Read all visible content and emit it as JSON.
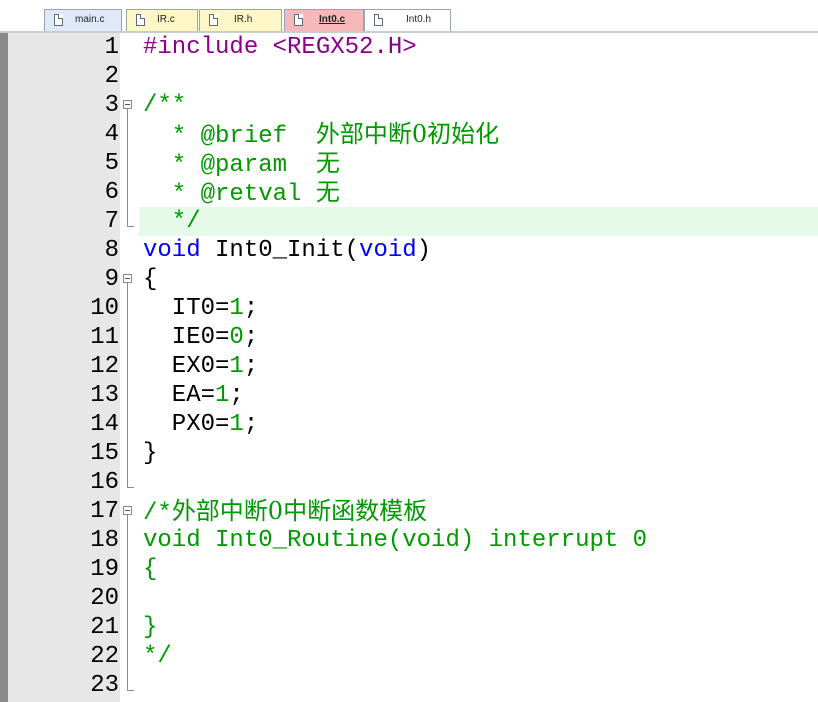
{
  "tabs": [
    {
      "label": "main.c",
      "icon": "file-icon"
    },
    {
      "label": "IR.c",
      "icon": "file-icon"
    },
    {
      "label": "IR.h",
      "icon": "file-icon"
    },
    {
      "label": "Int0.c",
      "icon": "file-icon",
      "active": true
    },
    {
      "label": "Int0.h",
      "icon": "file-icon"
    }
  ],
  "colors": {
    "preprocessor": "#8b008b",
    "comment": "#009a00",
    "keyword": "#0000ff",
    "number": "#009a00",
    "active_tab": "#f6b8b8",
    "current_line": "#e5fae8"
  },
  "code": {
    "line_numbers": [
      "1",
      "2",
      "3",
      "4",
      "5",
      "6",
      "7",
      "8",
      "9",
      "10",
      "11",
      "12",
      "13",
      "14",
      "15",
      "16",
      "17",
      "18",
      "19",
      "20",
      "21",
      "22",
      "23"
    ],
    "l1": "#include <REGX52.H>",
    "l3": "/**",
    "l4a": "  * @brief  ",
    "l4b": "外部中断0初始化",
    "l5a": "  * @param  ",
    "l5b": "无",
    "l6a": "  * @retval ",
    "l6b": "无",
    "l7": "  */",
    "l8_kw1": "void",
    "l8_name": " Int0_Init(",
    "l8_kw2": "void",
    "l8_end": ")",
    "l9": "{",
    "l10a": "  IT0=",
    "l10n": "1",
    "l10b": ";",
    "l11a": "  IE0=",
    "l11n": "0",
    "l11b": ";",
    "l12a": "  EX0=",
    "l12n": "1",
    "l12b": ";",
    "l13a": "  EA=",
    "l13n": "1",
    "l13b": ";",
    "l14a": "  PX0=",
    "l14n": "1",
    "l14b": ";",
    "l15": "}",
    "l17a": "/*",
    "l17b": "外部中断0中断函数模板",
    "l18": "void Int0_Routine(void) interrupt 0",
    "l19": "{",
    "l21": "}",
    "l22": "*/"
  }
}
